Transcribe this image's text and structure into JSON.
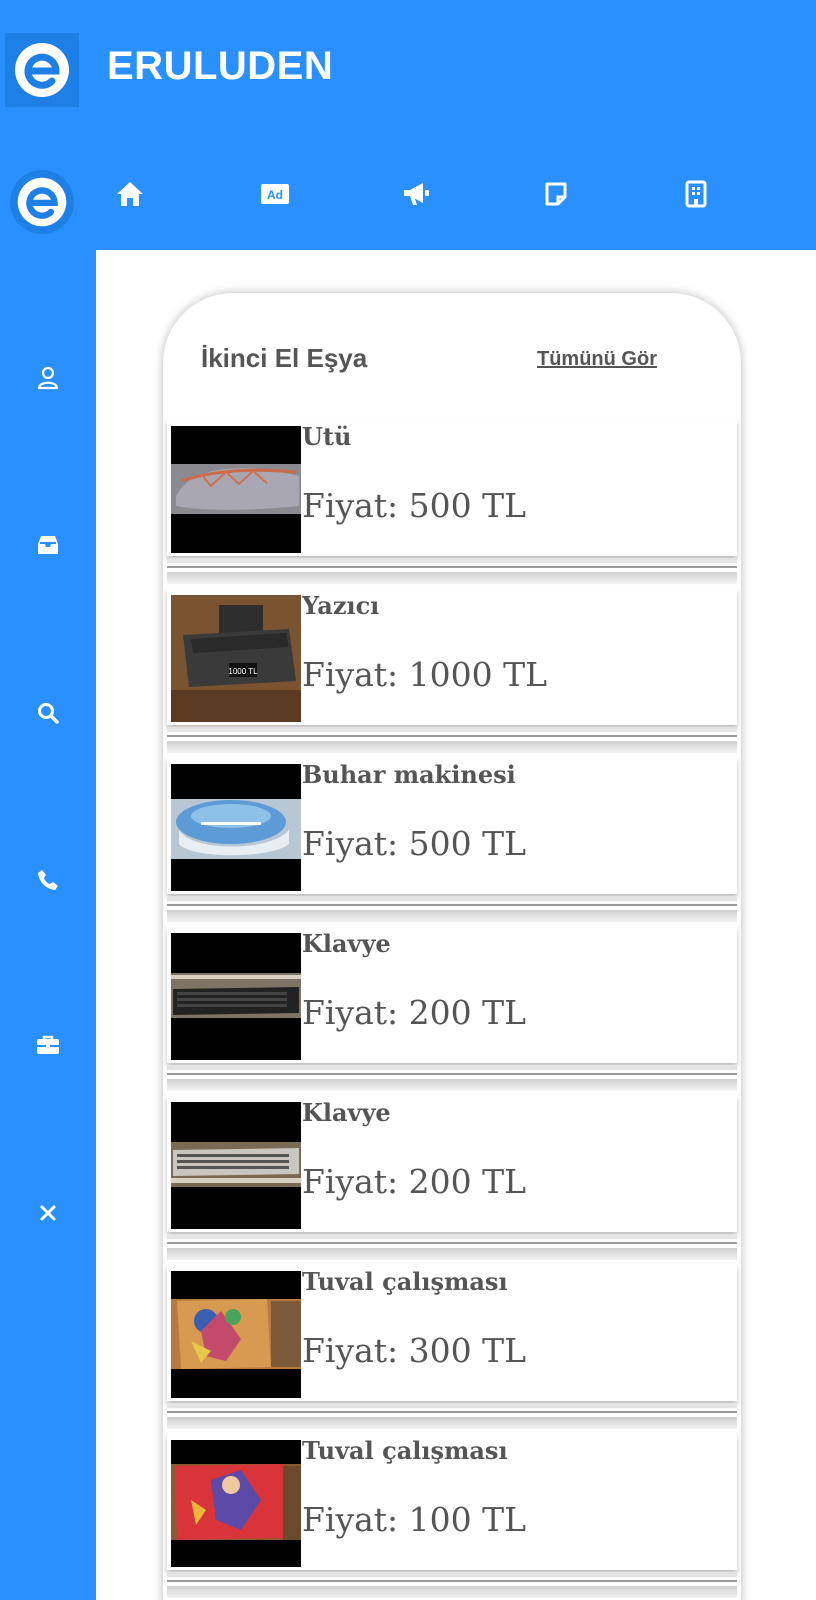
{
  "app": {
    "title": "ERULUDEN",
    "accent_color": "#2a90ff",
    "logo_icon": "eruluden-logo"
  },
  "nav": {
    "items": [
      {
        "icon": "home-icon"
      },
      {
        "icon": "ad-icon",
        "label": "Ad"
      },
      {
        "icon": "megaphone-icon"
      },
      {
        "icon": "note-icon"
      },
      {
        "icon": "building-icon"
      }
    ]
  },
  "sidebar": {
    "items": [
      {
        "icon": "user-icon"
      },
      {
        "icon": "inbox-icon"
      },
      {
        "icon": "search-icon"
      },
      {
        "icon": "phone-icon"
      },
      {
        "icon": "briefcase-icon"
      },
      {
        "icon": "close-icon"
      }
    ]
  },
  "section": {
    "title": "İkinci El Eşya",
    "see_all": "Tümünü Gör"
  },
  "listings": [
    {
      "name": "Utü",
      "price": "Fiyat: 500 TL",
      "image": "iron"
    },
    {
      "name": "Yazıcı",
      "price": "Fiyat: 1000 TL",
      "image": "printer",
      "image_caption": "1000 TL"
    },
    {
      "name": "Buhar makinesi",
      "price": "Fiyat: 500 TL",
      "image": "steamer"
    },
    {
      "name": "Klavye",
      "price": "Fiyat: 200 TL",
      "image": "keyboard"
    },
    {
      "name": "Klavye",
      "price": "Fiyat: 200 TL",
      "image": "keyboard"
    },
    {
      "name": "Tuval çalışması",
      "price": "Fiyat: 300 TL",
      "image": "canvas-painting"
    },
    {
      "name": "Tuval çalışması",
      "price": "Fiyat: 100 TL",
      "image": "canvas-painting"
    }
  ]
}
